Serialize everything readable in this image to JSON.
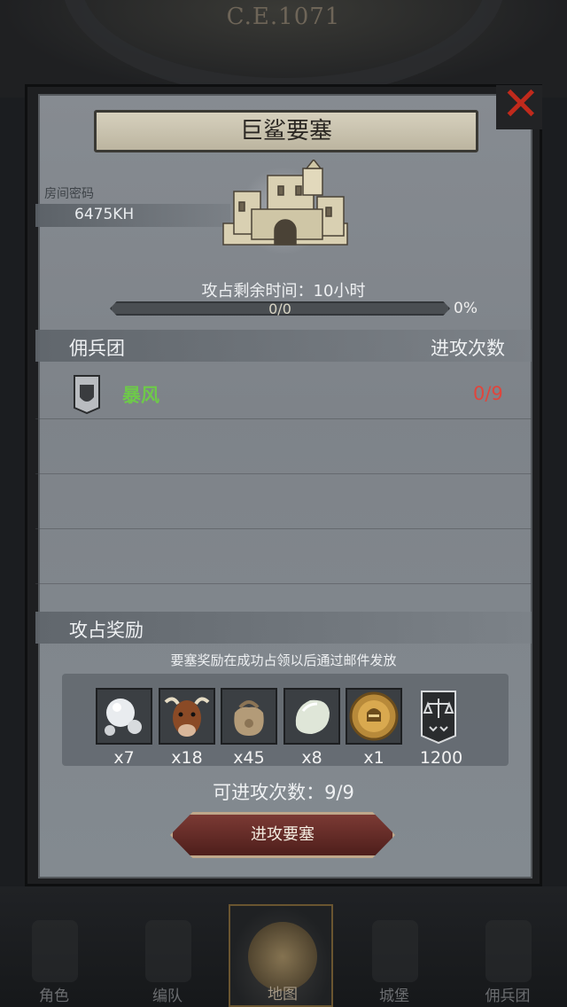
{
  "era": "C.E.1071",
  "fortress": {
    "name": "巨鲨要塞"
  },
  "room": {
    "label": "房间密码",
    "code": "6475KH"
  },
  "occupy": {
    "remaining_text": "攻占剩余时间：10小时",
    "progress_text": "0/0",
    "progress_percent_text": "0%",
    "progress_fraction": 0
  },
  "mercenary": {
    "col_left": "佣兵团",
    "col_right": "进攻次数",
    "rows": [
      {
        "name": "暴风",
        "count": "0/9",
        "icon": "shield-icon"
      }
    ]
  },
  "rewards": {
    "title": "攻占奖励",
    "note": "要塞奖励在成功占领以后通过邮件发放",
    "items": [
      {
        "icon": "pearl-icon",
        "qty": "x7"
      },
      {
        "icon": "ox-icon",
        "qty": "x18"
      },
      {
        "icon": "sack-icon",
        "qty": "x45"
      },
      {
        "icon": "moonstone-icon",
        "qty": "x8"
      },
      {
        "icon": "knight-medal-icon",
        "qty": "x1"
      },
      {
        "icon": "guild-banner-icon",
        "qty": "1200"
      }
    ]
  },
  "attempts_text": "可进攻次数：9/9",
  "attack_button": "进攻要塞",
  "nav": [
    {
      "label": "角色",
      "active": false
    },
    {
      "label": "编队",
      "active": false
    },
    {
      "label": "地图",
      "active": true
    },
    {
      "label": "城堡",
      "active": false
    },
    {
      "label": "佣兵团",
      "active": false
    }
  ],
  "colors": {
    "accent_green": "#6ec94a",
    "count_red": "#e0453c",
    "close_red": "#c02a1c"
  }
}
